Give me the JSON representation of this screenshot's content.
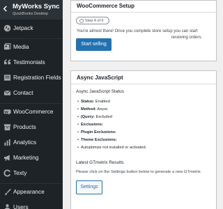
{
  "sidebar": {
    "brand_title": "MyWorks Sync",
    "brand_subtitle": "QuickBooks Desktop",
    "items": [
      {
        "label": "Jetpack",
        "icon": "jetpack-icon"
      },
      {
        "label": "Media",
        "icon": "media-icon"
      },
      {
        "label": "Testimonials",
        "icon": "quote-icon"
      },
      {
        "label": "Registration Fields",
        "icon": "registration-icon"
      },
      {
        "label": "Contact",
        "icon": "mail-icon"
      },
      {
        "label": "WooCommerce",
        "icon": "woocommerce-icon"
      },
      {
        "label": "Products",
        "icon": "archive-icon"
      },
      {
        "label": "Analytics",
        "icon": "chart-icon"
      },
      {
        "label": "Marketing",
        "icon": "megaphone-icon"
      },
      {
        "label": "Texty",
        "icon": "texty-icon"
      },
      {
        "label": "Appearance",
        "icon": "paintbrush-icon"
      },
      {
        "label": "Users",
        "icon": "users-icon"
      }
    ]
  },
  "woo_setup": {
    "title": "WooCommerce Setup",
    "step_label": "Step 4 of 6",
    "message_line1": "You're almost there! Once you complete store setup you can start",
    "message_line2": "receiving orders.",
    "button": "Start selling"
  },
  "async": {
    "title": "Async JavaScript",
    "status_heading": "Async JavaScript Status",
    "status_items": [
      {
        "label": "Status:",
        "value": "Enabled"
      },
      {
        "label": "Method:",
        "value": "Async"
      },
      {
        "label": "jQuery:",
        "value": "Excluded"
      },
      {
        "label": "Exclusions:",
        "value": ""
      },
      {
        "label": "Plugin Exclusions:",
        "value": ""
      },
      {
        "label": "Theme Exclusions:",
        "value": ""
      },
      {
        "label": "",
        "value": "Autoptimize not installed or activated."
      }
    ],
    "gtmetrix_heading": "Latest GTmetrix Results",
    "gtmetrix_text": "Please click on the Settings button below to generate a new GTmetrix",
    "settings_button": "Settings"
  },
  "colors": {
    "sidebar_bg": "#1d2327",
    "accent": "#2271b1"
  }
}
